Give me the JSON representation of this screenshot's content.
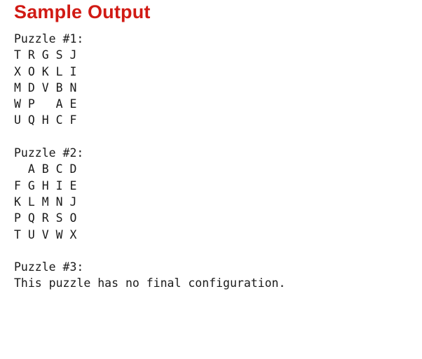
{
  "heading": "Sample Output",
  "puzzles": [
    {
      "title": "Puzzle #1:",
      "rows": [
        "T R G S J",
        "X O K L I",
        "M D V B N",
        "W P   A E",
        "U Q H C F"
      ]
    },
    {
      "title": "Puzzle #2:",
      "rows": [
        "  A B C D",
        "F G H I E",
        "K L M N J",
        "P Q R S O",
        "T U V W X"
      ]
    },
    {
      "title": "Puzzle #3:",
      "message": "This puzzle has no final configuration."
    }
  ]
}
